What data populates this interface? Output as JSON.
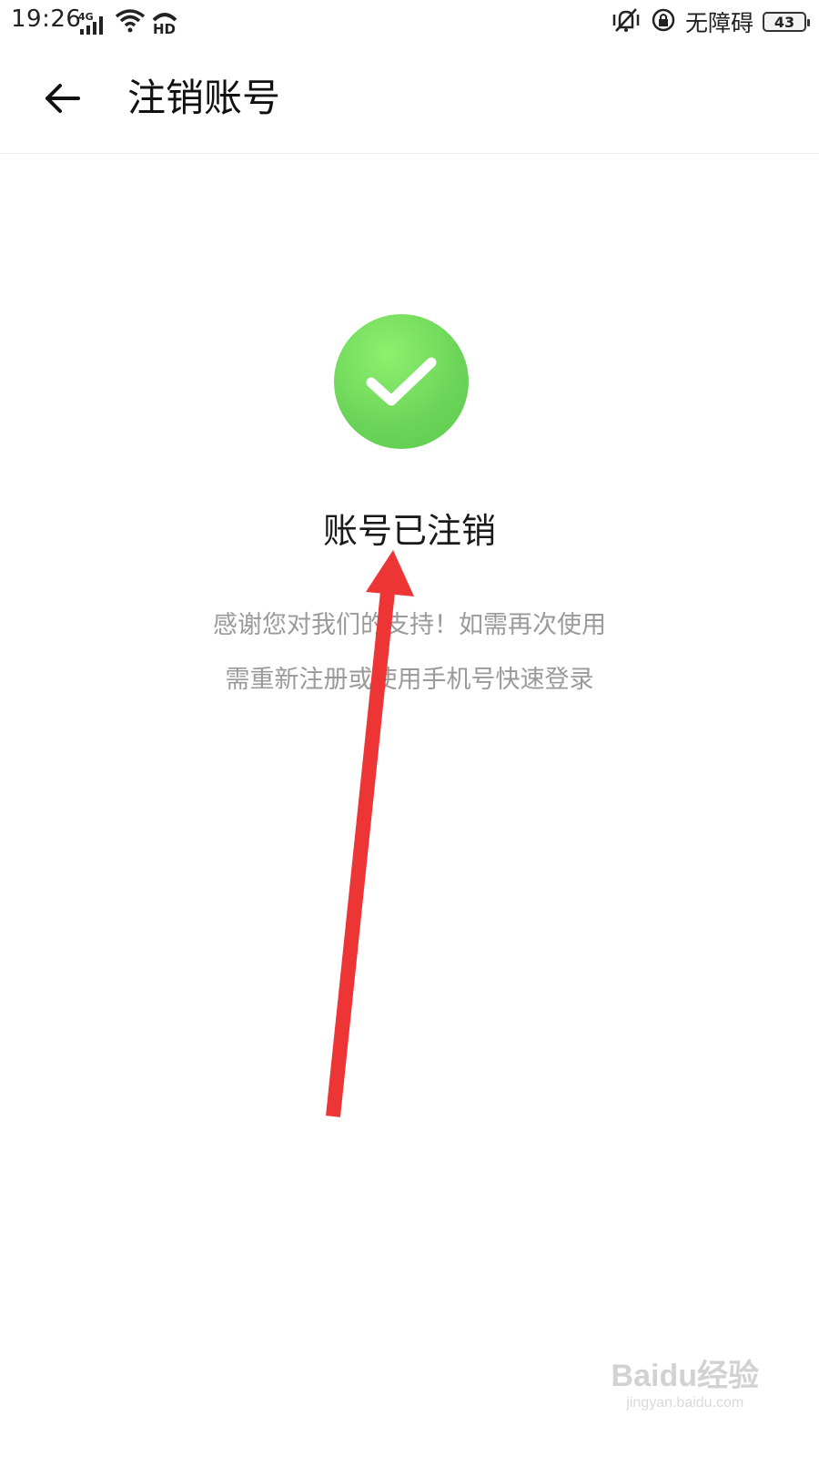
{
  "status_bar": {
    "time": "19:26",
    "network": "4G",
    "hd": "HD",
    "accessibility": "无障碍",
    "battery": "43"
  },
  "header": {
    "title": "注销账号",
    "back_icon": "arrow-left-icon"
  },
  "result": {
    "icon": "check-circle-icon",
    "icon_color": "#6ad458",
    "title": "账号已注销",
    "message_line1": "感谢您对我们的支持！如需再次使用",
    "message_line2": "需重新注册或使用手机号快速登录"
  },
  "annotation": {
    "arrow_color": "#ee3535"
  },
  "watermark": {
    "brand": "Baidu经验",
    "url": "jingyan.baidu.com"
  }
}
